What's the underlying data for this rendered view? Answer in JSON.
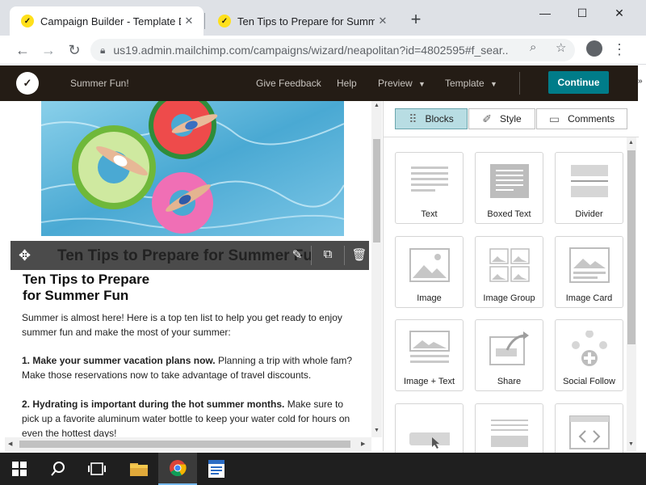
{
  "browser": {
    "tabs": [
      {
        "title": "Campaign Builder - Template De",
        "active": true
      },
      {
        "title": "Ten Tips to Prepare for Summer F",
        "active": false
      }
    ],
    "url": "us19.admin.mailchimp.com/campaigns/wizard/neapolitan?id=4802595#f_sear..."
  },
  "mailchimp": {
    "campaign_name": "Summer Fun!",
    "nav": {
      "give_feedback": "Give Feedback",
      "help": "Help",
      "preview": "Preview",
      "template": "Template"
    },
    "continue": "Continue"
  },
  "editor": {
    "block_toolbar_ghost": "Ten Tips to Prepare for Summer Fu",
    "title_line1": "Ten Tips to Prepare",
    "title_line2": "for Summer Fun",
    "intro": "Summer is almost here! Here is a top ten list to help you get ready to enjoy summer fun and make the most of your summer:",
    "tip1_bold": "1. Make your summer vacation plans now.",
    "tip1_text": " Planning a trip with whole fam? Make those reservations now to take advantage of travel discounts.",
    "tip2_bold": "2. Hydrating is important during the hot summer months.",
    "tip2_text": "  Make sure to pick up a favorite aluminum water bottle to keep your water cold for hours on even the hottest days!"
  },
  "sidebar": {
    "tabs": [
      {
        "label": "Blocks",
        "icon": "grid-icon",
        "active": true
      },
      {
        "label": "Style",
        "icon": "brush-icon",
        "active": false
      },
      {
        "label": "Comments",
        "icon": "comment-icon",
        "active": false
      }
    ],
    "blocks": [
      {
        "label": "Text",
        "icon": "text-block-icon"
      },
      {
        "label": "Boxed Text",
        "icon": "boxed-text-icon"
      },
      {
        "label": "Divider",
        "icon": "divider-icon"
      },
      {
        "label": "Image",
        "icon": "image-icon"
      },
      {
        "label": "Image Group",
        "icon": "image-group-icon"
      },
      {
        "label": "Image Card",
        "icon": "image-card-icon"
      },
      {
        "label": "Image + Text",
        "icon": "image-text-icon"
      },
      {
        "label": "Share",
        "icon": "share-icon"
      },
      {
        "label": "Social Follow",
        "icon": "social-follow-icon"
      },
      {
        "label": "",
        "icon": "button-block-icon"
      },
      {
        "label": "",
        "icon": "footer-block-icon"
      },
      {
        "label": "",
        "icon": "code-block-icon"
      }
    ]
  },
  "taskbar": {
    "items": [
      "start-icon",
      "search-icon",
      "task-view-icon",
      "file-explorer-icon",
      "chrome-icon",
      "wordpad-icon"
    ],
    "active": "chrome-icon"
  }
}
